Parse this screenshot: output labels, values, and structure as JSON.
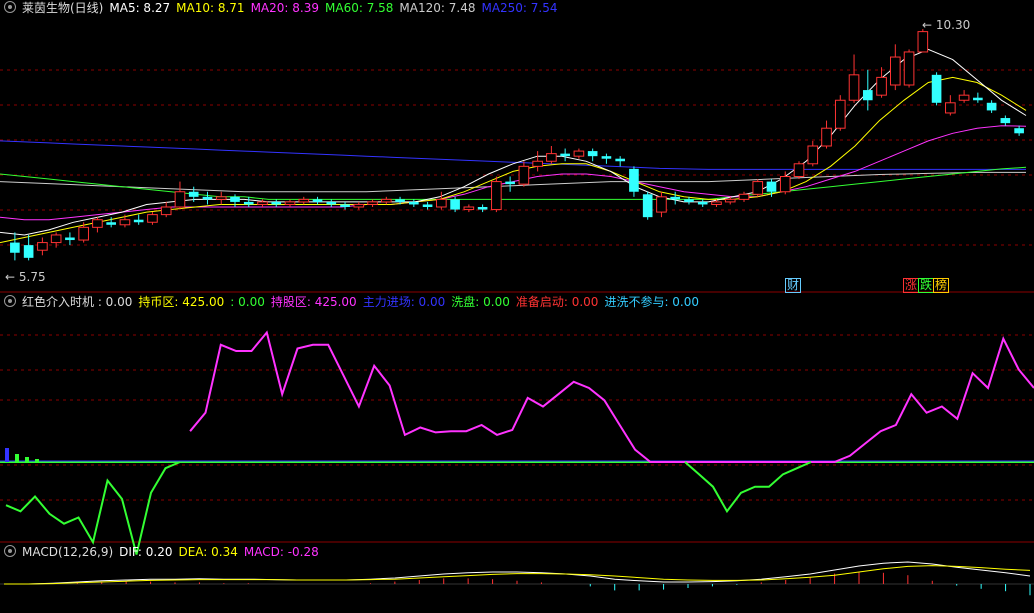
{
  "panels": {
    "price": {
      "title": "莱茵生物(日线)",
      "legend": [
        {
          "label": "MA5: 8.27",
          "color": "#ffffff"
        },
        {
          "label": "MA10: 8.71",
          "color": "#ffff00"
        },
        {
          "label": "MA20: 8.39",
          "color": "#ff33ff"
        },
        {
          "label": "MA60: 7.58",
          "color": "#33ff33"
        },
        {
          "label": "MA120: 7.48",
          "color": "#cccccc"
        },
        {
          "label": "MA250: 7.54",
          "color": "#3333ff"
        }
      ],
      "high_label": "10.30",
      "low_label": "5.75",
      "badges": [
        {
          "text": "财",
          "color": "#66ccff"
        },
        {
          "text": "涨",
          "color": "#ff3333"
        },
        {
          "text": "跌",
          "color": "#33ff33"
        },
        {
          "text": "榜",
          "color": "#ffcc00"
        }
      ]
    },
    "indicator": {
      "legend": [
        {
          "label": "红色介入时机 : 0.00",
          "color": "#dddddd"
        },
        {
          "label": "持币区: 425.00",
          "color": "#ffff00"
        },
        {
          "label": ": 0.00",
          "color": "#33ff33"
        },
        {
          "label": "持股区: 425.00",
          "color": "#ff33ff"
        },
        {
          "label": "主力进场: 0.00",
          "color": "#3333ff"
        },
        {
          "label": "洗盘: 0.00",
          "color": "#33ff33"
        },
        {
          "label": "准备启动: 0.00",
          "color": "#ff3333"
        },
        {
          "label": "进洗不参与: 0.00",
          "color": "#33ccff"
        }
      ]
    },
    "macd": {
      "legend": [
        {
          "label": "MACD(12,26,9)",
          "color": "#dddddd"
        },
        {
          "label": "DIF: 0.20",
          "color": "#ffffff"
        },
        {
          "label": "DEA: 0.34",
          "color": "#ffff00"
        },
        {
          "label": "MACD: -0.28",
          "color": "#ff33ff"
        }
      ]
    }
  },
  "colors": {
    "up": "#ff3333",
    "down": "#33ffff",
    "grid": "#8b0000",
    "ma5": "#ffffff",
    "ma10": "#ffff00",
    "ma20": "#ff33ff",
    "ma60": "#33ff33",
    "ma120": "#cccccc",
    "ma250": "#3333ff",
    "hold": "#ff33ff",
    "cash": "#33ff33",
    "base": "#3333ff"
  },
  "chart_data": {
    "type": "candlestick",
    "price_range": [
      5.6,
      10.4
    ],
    "candles": [
      [
        6.1,
        5.9,
        6.3,
        5.75
      ],
      [
        6.05,
        5.8,
        6.25,
        5.75
      ],
      [
        5.95,
        6.1,
        6.2,
        5.85
      ],
      [
        6.1,
        6.25,
        6.3,
        6.0
      ],
      [
        6.2,
        6.15,
        6.3,
        6.05
      ],
      [
        6.15,
        6.4,
        6.5,
        6.1
      ],
      [
        6.4,
        6.55,
        6.6,
        6.3
      ],
      [
        6.5,
        6.45,
        6.6,
        6.4
      ],
      [
        6.45,
        6.55,
        6.65,
        6.4
      ],
      [
        6.55,
        6.5,
        6.65,
        6.45
      ],
      [
        6.5,
        6.65,
        6.7,
        6.45
      ],
      [
        6.65,
        6.8,
        6.9,
        6.6
      ],
      [
        6.8,
        7.1,
        7.3,
        6.75
      ],
      [
        7.1,
        7.0,
        7.2,
        6.9
      ],
      [
        7.0,
        6.95,
        7.1,
        6.85
      ],
      [
        6.95,
        7.0,
        7.1,
        6.85
      ],
      [
        7.0,
        6.9,
        7.05,
        6.8
      ],
      [
        6.9,
        6.85,
        7.0,
        6.8
      ],
      [
        6.85,
        6.9,
        6.95,
        6.8
      ],
      [
        6.9,
        6.85,
        6.95,
        6.8
      ],
      [
        6.85,
        6.9,
        6.95,
        6.8
      ],
      [
        6.9,
        6.95,
        7.0,
        6.85
      ],
      [
        6.95,
        6.9,
        7.0,
        6.85
      ],
      [
        6.9,
        6.85,
        6.95,
        6.8
      ],
      [
        6.85,
        6.8,
        6.9,
        6.75
      ],
      [
        6.8,
        6.85,
        6.9,
        6.75
      ],
      [
        6.85,
        6.9,
        6.95,
        6.8
      ],
      [
        6.9,
        6.95,
        7.0,
        6.85
      ],
      [
        6.95,
        6.9,
        7.0,
        6.85
      ],
      [
        6.9,
        6.85,
        6.95,
        6.8
      ],
      [
        6.85,
        6.8,
        6.9,
        6.75
      ],
      [
        6.8,
        6.95,
        7.1,
        6.75
      ],
      [
        6.95,
        6.75,
        7.0,
        6.7
      ],
      [
        6.75,
        6.8,
        6.85,
        6.7
      ],
      [
        6.8,
        6.75,
        6.85,
        6.7
      ],
      [
        6.75,
        7.3,
        7.4,
        6.7
      ],
      [
        7.3,
        7.25,
        7.4,
        7.1
      ],
      [
        7.25,
        7.6,
        7.7,
        7.2
      ],
      [
        7.6,
        7.7,
        7.9,
        7.5
      ],
      [
        7.7,
        7.85,
        8.0,
        7.65
      ],
      [
        7.85,
        7.8,
        7.95,
        7.7
      ],
      [
        7.8,
        7.9,
        7.95,
        7.75
      ],
      [
        7.9,
        7.8,
        7.95,
        7.7
      ],
      [
        7.8,
        7.75,
        7.85,
        7.65
      ],
      [
        7.75,
        7.7,
        7.8,
        7.6
      ],
      [
        7.55,
        7.1,
        7.6,
        7.0
      ],
      [
        7.05,
        6.6,
        7.1,
        6.55
      ],
      [
        6.7,
        7.0,
        7.1,
        6.6
      ],
      [
        7.0,
        6.95,
        7.1,
        6.85
      ],
      [
        6.95,
        6.9,
        7.0,
        6.85
      ],
      [
        6.9,
        6.85,
        6.95,
        6.8
      ],
      [
        6.85,
        6.9,
        6.95,
        6.8
      ],
      [
        6.9,
        6.95,
        7.0,
        6.85
      ],
      [
        6.95,
        7.05,
        7.1,
        6.9
      ],
      [
        7.05,
        7.3,
        7.35,
        7.0
      ],
      [
        7.3,
        7.1,
        7.35,
        7.0
      ],
      [
        7.1,
        7.4,
        7.5,
        7.05
      ],
      [
        7.4,
        7.65,
        7.7,
        7.35
      ],
      [
        7.65,
        8.0,
        8.1,
        7.6
      ],
      [
        8.0,
        8.35,
        8.5,
        7.95
      ],
      [
        8.35,
        8.9,
        9.0,
        8.3
      ],
      [
        8.9,
        9.4,
        9.8,
        8.85
      ],
      [
        9.1,
        8.9,
        9.5,
        8.7
      ],
      [
        9.0,
        9.35,
        9.55,
        8.95
      ],
      [
        9.2,
        9.75,
        10.0,
        9.1
      ],
      [
        9.2,
        9.85,
        9.9,
        9.15
      ],
      [
        9.85,
        10.25,
        10.3,
        9.85
      ],
      [
        9.4,
        8.85,
        9.45,
        8.8
      ],
      [
        8.65,
        8.85,
        9.0,
        8.6
      ],
      [
        8.9,
        9.0,
        9.1,
        8.85
      ],
      [
        8.95,
        8.9,
        9.05,
        8.85
      ],
      [
        8.85,
        8.7,
        8.9,
        8.65
      ],
      [
        8.55,
        8.45,
        8.6,
        8.4
      ],
      [
        8.35,
        8.25,
        8.4,
        8.2
      ]
    ],
    "ma_lines": {
      "ma5": [
        6.3,
        6.25,
        6.35,
        6.5,
        6.6,
        6.7,
        6.85,
        6.9,
        6.95,
        6.95,
        6.95,
        6.9,
        6.9,
        6.9,
        6.9,
        6.9,
        6.9,
        6.9,
        7.0,
        7.2,
        7.45,
        7.65,
        7.8,
        7.8,
        7.7,
        7.5,
        7.2,
        7.0,
        6.9,
        6.9,
        7.0,
        7.1,
        7.35,
        7.7,
        8.2,
        8.8,
        9.3,
        9.7,
        9.9,
        9.7,
        9.3,
        8.9,
        8.6
      ],
      "ma10": [
        6.1,
        6.2,
        6.3,
        6.4,
        6.5,
        6.6,
        6.7,
        6.75,
        6.8,
        6.85,
        6.85,
        6.85,
        6.85,
        6.85,
        6.85,
        6.85,
        6.85,
        6.9,
        6.95,
        7.1,
        7.3,
        7.5,
        7.6,
        7.65,
        7.65,
        7.5,
        7.3,
        7.1,
        7.0,
        6.95,
        6.95,
        7.0,
        7.1,
        7.3,
        7.6,
        8.0,
        8.5,
        8.9,
        9.25,
        9.35,
        9.25,
        9.0,
        8.7
      ],
      "ma20": [
        6.6,
        6.55,
        6.55,
        6.6,
        6.65,
        6.7,
        6.75,
        6.8,
        6.8,
        6.8,
        6.8,
        6.8,
        6.8,
        6.8,
        6.8,
        6.85,
        6.85,
        6.9,
        6.95,
        7.05,
        7.2,
        7.3,
        7.4,
        7.45,
        7.45,
        7.4,
        7.3,
        7.2,
        7.1,
        7.05,
        7.0,
        7.0,
        7.1,
        7.2,
        7.35,
        7.5,
        7.7,
        7.9,
        8.1,
        8.25,
        8.35,
        8.4,
        8.39
      ],
      "ma60": [
        7.45,
        7.4,
        7.35,
        7.3,
        7.25,
        7.2,
        7.15,
        7.1,
        7.05,
        7.0,
        7.0,
        6.95,
        6.95,
        6.95,
        6.95,
        6.95,
        6.95,
        6.95,
        6.95,
        6.95,
        6.95,
        6.95,
        6.95,
        6.95,
        6.95,
        6.95,
        6.95,
        6.95,
        6.95,
        6.95,
        7.0,
        7.05,
        7.1,
        7.15,
        7.2,
        7.25,
        7.3,
        7.35,
        7.4,
        7.45,
        7.5,
        7.55,
        7.58
      ],
      "ma120": [
        7.3,
        7.28,
        7.26,
        7.24,
        7.22,
        7.2,
        7.18,
        7.16,
        7.14,
        7.12,
        7.1,
        7.1,
        7.1,
        7.1,
        7.1,
        7.1,
        7.12,
        7.14,
        7.16,
        7.18,
        7.2,
        7.22,
        7.24,
        7.26,
        7.28,
        7.3,
        7.3,
        7.3,
        7.3,
        7.3,
        7.32,
        7.34,
        7.36,
        7.38,
        7.4,
        7.42,
        7.44,
        7.45,
        7.46,
        7.47,
        7.48,
        7.48,
        7.48
      ],
      "ma250": [
        8.1,
        8.08,
        8.06,
        8.04,
        8.02,
        8.0,
        7.98,
        7.96,
        7.94,
        7.92,
        7.9,
        7.88,
        7.86,
        7.84,
        7.82,
        7.8,
        7.78,
        7.76,
        7.74,
        7.72,
        7.7,
        7.68,
        7.66,
        7.64,
        7.62,
        7.6,
        7.58,
        7.56,
        7.55,
        7.54,
        7.54,
        7.54,
        7.54,
        7.54,
        7.54,
        7.54,
        7.54,
        7.54,
        7.54,
        7.54,
        7.54,
        7.54,
        7.54
      ]
    },
    "indicator": {
      "range": [
        -60,
        120
      ],
      "baseline": 0,
      "hold_zone": [
        null,
        null,
        null,
        null,
        null,
        null,
        null,
        null,
        null,
        null,
        null,
        null,
        25,
        40,
        95,
        90,
        90,
        105,
        55,
        92,
        95,
        95,
        70,
        45,
        78,
        62,
        22,
        28,
        24,
        25,
        25,
        30,
        22,
        26,
        52,
        45,
        55,
        65,
        60,
        50,
        30,
        10,
        0,
        0,
        0,
        0,
        0,
        0,
        0,
        0,
        0,
        0,
        0,
        0,
        0,
        5,
        15,
        25,
        30,
        55,
        40,
        45,
        35,
        72,
        60,
        100,
        75,
        60
      ],
      "cash_zone": [
        -35,
        -40,
        -28,
        -42,
        -50,
        -45,
        -65,
        -15,
        -30,
        -75,
        -25,
        -5,
        0
      ],
      "cash_zone_2": [
        0,
        -10,
        -20,
        -40,
        -25,
        -20,
        -20,
        -10,
        -5,
        0
      ],
      "small_bars": [
        14,
        8,
        5,
        3
      ]
    },
    "macd": {
      "range": [
        -0.6,
        0.6
      ],
      "dif": [
        0.0,
        0.0,
        0.02,
        0.05,
        0.08,
        0.1,
        0.12,
        0.12,
        0.13,
        0.12,
        0.12,
        0.11,
        0.1,
        0.1,
        0.1,
        0.12,
        0.15,
        0.2,
        0.25,
        0.28,
        0.3,
        0.3,
        0.28,
        0.25,
        0.2,
        0.12,
        0.08,
        0.05,
        0.05,
        0.06,
        0.08,
        0.12,
        0.18,
        0.25,
        0.35,
        0.45,
        0.52,
        0.55,
        0.5,
        0.42,
        0.35,
        0.28,
        0.2
      ],
      "dea": [
        0.0,
        0.0,
        0.01,
        0.03,
        0.05,
        0.07,
        0.09,
        0.1,
        0.11,
        0.11,
        0.11,
        0.11,
        0.1,
        0.1,
        0.1,
        0.11,
        0.12,
        0.15,
        0.18,
        0.21,
        0.24,
        0.26,
        0.26,
        0.25,
        0.23,
        0.2,
        0.16,
        0.12,
        0.1,
        0.09,
        0.09,
        0.1,
        0.13,
        0.17,
        0.22,
        0.3,
        0.38,
        0.44,
        0.46,
        0.44,
        0.41,
        0.37,
        0.34
      ]
    }
  }
}
